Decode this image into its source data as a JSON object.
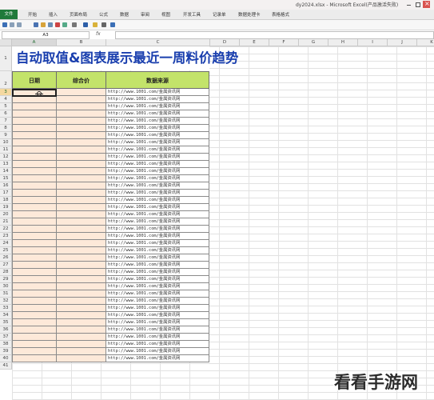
{
  "window": {
    "title": "dy2024.xlsx - Microsoft Excel(产品激活失败)"
  },
  "ribbon": {
    "tabs": [
      "文件",
      "开始",
      "插入",
      "页面布局",
      "公式",
      "数据",
      "审阅",
      "视图",
      "开发工具",
      "记录单",
      "数据处理卡",
      "表格格式"
    ]
  },
  "formula_bar": {
    "name_box": "A3",
    "fx_label": "fx",
    "value": ""
  },
  "sheet": {
    "columns": [
      "A",
      "B",
      "C",
      "D",
      "E",
      "F",
      "G",
      "H",
      "I",
      "J",
      "K"
    ],
    "selected_column": "A",
    "row_numbers": [
      "1",
      "2",
      "3",
      "4",
      "5",
      "6",
      "7",
      "8",
      "9",
      "10",
      "11",
      "12",
      "13",
      "14",
      "15",
      "16",
      "17",
      "18",
      "19",
      "20",
      "21",
      "22",
      "23",
      "24",
      "25",
      "26",
      "27",
      "28",
      "29",
      "30",
      "31",
      "32",
      "33",
      "34",
      "35",
      "36",
      "37",
      "38",
      "39",
      "40",
      "41"
    ],
    "selected_row": "3",
    "title": "自动取值&图表展示最近一周料价趋势",
    "headers": [
      "日期",
      "综合价",
      "数据来源"
    ],
    "url_text": "http://www.1001.com/金属资讯网",
    "url_row_count": 38,
    "colors": {
      "title": "#1a3fae",
      "header_fill": "#c3e36a",
      "data_fill": "#fde9d9",
      "ribbon_file": "#1f7a3a"
    }
  },
  "watermark": {
    "text": "看看手游网"
  }
}
